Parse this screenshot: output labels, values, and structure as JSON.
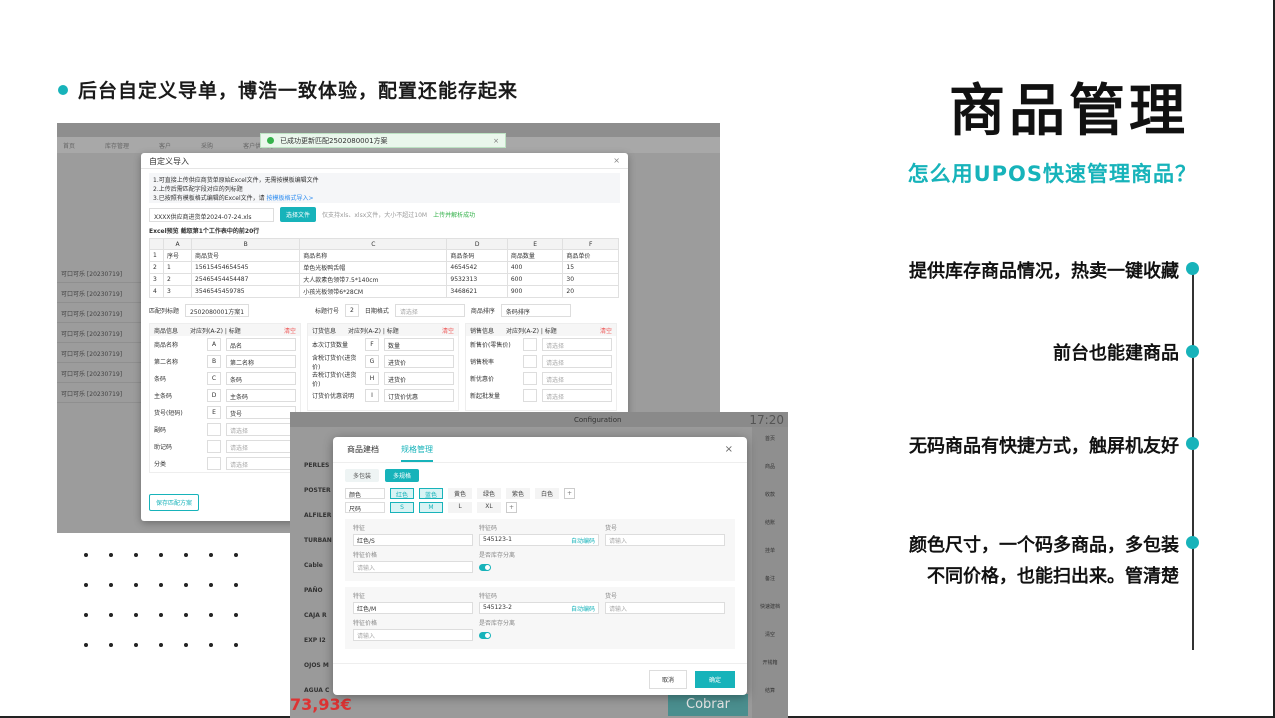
{
  "accent": "#17b3ba",
  "headline": "后台自定义导单，博浩一致体验，配置还能存起来",
  "title": "商品管理",
  "subtitle": "怎么用UPOS快速管理商品？",
  "features": [
    "提供库存商品情况，热卖一键收藏",
    "前台也能建商品",
    "无码商品有快捷方式，触屏机友好",
    "颜色尺寸，一个码多商品，多包装",
    "不同价格，也能扫出来。管清楚"
  ],
  "shot1": {
    "tabs": [
      "首页",
      "库存管理",
      "客户",
      "采购",
      "客户供应商"
    ],
    "list_rows": [
      "可口可乐 [20230719]",
      "可口可乐 [20230719]",
      "可口可乐 [20230719]",
      "可口可乐 [20230719]",
      "可口可乐 [20230719]",
      "可口可乐 [20230719]",
      "可口可乐 [20230719]"
    ],
    "toast": "已成功更新匹配2502080001方案",
    "modal_title": "自定义导入",
    "notes": [
      "1.可直接上传供应商货单原始Excel文件，无需按模板编辑文件",
      "2.上传后需匹配字段对应的列标题",
      "3.已按照有模板格式编辑的Excel文件，请",
      "按模板格式导入>"
    ],
    "file_name": "XXXX供应商进货单2024-07-24.xls",
    "choose_file": "选择文件",
    "file_hint": "仅支持xls、xlsx文件，大小不超过10M",
    "upload_ok": "上传并解析成功",
    "preview_label": "Excel预览  截取第1个工作表中的前20行",
    "excel_cols": [
      "",
      "A",
      "B",
      "C",
      "D",
      "E",
      "F"
    ],
    "excel_rows": [
      [
        "1",
        "序号",
        "商品货号",
        "商品名称",
        "商品条码",
        "商品数量",
        "商品单价"
      ],
      [
        "2",
        "1",
        "15615454654545",
        "单色光板鸭舌帽",
        "4654542",
        "400",
        "15"
      ],
      [
        "3",
        "2",
        "25465454454487",
        "大人款素色领带7.5*140cm",
        "9532313",
        "600",
        "30"
      ],
      [
        "4",
        "3",
        "3546545459785",
        "小孩光板领带6*28CM",
        "3468621",
        "900",
        "20"
      ]
    ],
    "match_label": "匹配列标题",
    "match_value": "2502080001方案1",
    "title_row_label": "标题行号",
    "title_row_value": "2",
    "date_label": "日期格式",
    "date_ph": "请选择",
    "sort_label": "商品排序",
    "sort_value": "条码排序",
    "columns": [
      {
        "head": [
          "商品信息",
          "对应列(A-Z) | 标题",
          "清空"
        ],
        "rows": [
          [
            "商品名称",
            "A",
            "品名"
          ],
          [
            "第二名称",
            "B",
            "第二名称"
          ],
          [
            "条码",
            "C",
            "条码"
          ],
          [
            "主条码",
            "D",
            "主条码"
          ],
          [
            "货号(短码)",
            "E",
            "货号"
          ],
          [
            "副码",
            "",
            "请选择"
          ],
          [
            "助记码",
            "",
            "请选择"
          ],
          [
            "分类",
            "",
            "请选择"
          ]
        ]
      },
      {
        "head": [
          "订货信息",
          "对应列(A-Z) | 标题",
          "清空"
        ],
        "rows": [
          [
            "本次订货数量",
            "F",
            "数量"
          ],
          [
            "含税订货价(进货价)",
            "G",
            "进货价"
          ],
          [
            "去税订货价(进货价)",
            "H",
            "进货价"
          ],
          [
            "订货价优惠说明",
            "I",
            "订货价优惠"
          ]
        ]
      },
      {
        "head": [
          "销售信息",
          "对应列(A-Z) | 标题",
          "清空"
        ],
        "rows": [
          [
            "新售价(零售价)",
            "",
            "请选择"
          ],
          [
            "销售税率",
            "",
            "请选择"
          ],
          [
            "新优惠价",
            "",
            "请选择"
          ],
          [
            "新起批发量",
            "",
            "请选择"
          ]
        ]
      }
    ],
    "save_btn": "保存匹配方案"
  },
  "shot2": {
    "top_text": "Configuration",
    "time": "17:20",
    "items": [
      "PERLES",
      "POSTER",
      "ALFILER",
      "TURBAN",
      "Cable",
      "PAÑO",
      "CAJA R",
      "EXP I2",
      "OJOS M",
      "AGUA C"
    ],
    "side": [
      "首页",
      "商品",
      "收款",
      "结账",
      "挂单",
      "备注",
      "快速建档",
      "清空",
      "开钱箱",
      "结算",
      "清空"
    ],
    "price": "73,93€",
    "cobrar": "Cobrar",
    "modal": {
      "tabs": [
        "商品建档",
        "规格管理"
      ],
      "sub": [
        "多包装",
        "多规格"
      ],
      "color_label": "颜色",
      "colors": [
        "红色",
        "蓝色",
        "黄色",
        "绿色",
        "紫色",
        "白色"
      ],
      "size_label": "尺码",
      "sizes": [
        "S",
        "M",
        "L",
        "XL"
      ],
      "variants": [
        {
          "spec": "红色/S",
          "code": "545123-1"
        },
        {
          "spec": "红色/M",
          "code": "545123-2"
        }
      ],
      "h_spec": "特征",
      "h_code": "特征码",
      "h_no": "货号",
      "h_price": "特征价格",
      "h_stock": "是否库存分离",
      "auto": "自动编码",
      "ph": "请输入",
      "cancel": "取消",
      "ok": "确定"
    }
  }
}
